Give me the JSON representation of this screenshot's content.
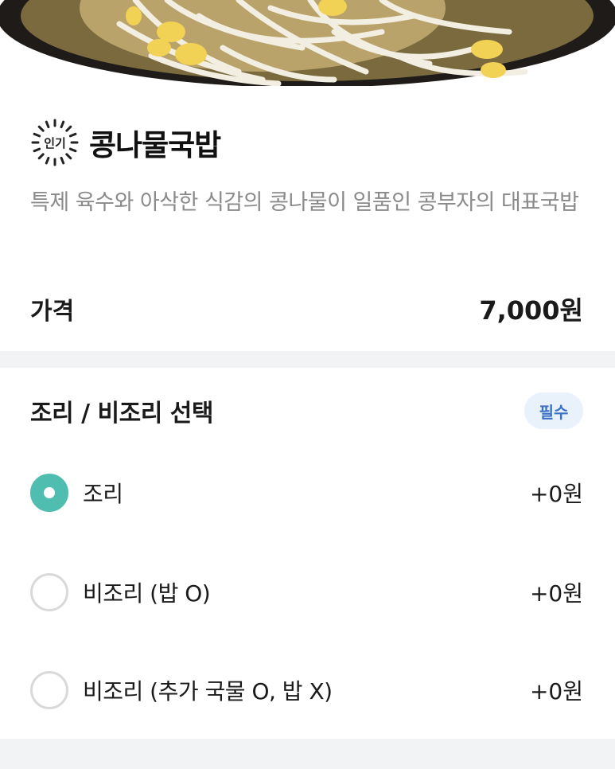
{
  "hero": {
    "image": "bean-sprout-soup-photo"
  },
  "menu": {
    "badge": "인기",
    "badge_icon": "popular-starburst-icon",
    "title": "콩나물국밥",
    "description": "특제 육수와 아삭한 식감의 콩나물이 일품인 콩부자의 대표국밥",
    "price_label": "가격",
    "price_value": "7,000원"
  },
  "options": {
    "title": "조리 / 비조리 선택",
    "required_label": "필수",
    "items": [
      {
        "label": "조리",
        "price": "+0원",
        "selected": true
      },
      {
        "label": "비조리 (밥 O)",
        "price": "+0원",
        "selected": false
      },
      {
        "label": "비조리 (추가 국물 O, 밥 X)",
        "price": "+0원",
        "selected": false
      }
    ]
  },
  "colors": {
    "accent": "#4fbdb0",
    "required_badge_bg": "#e9f1fb",
    "required_badge_text": "#3a72c4",
    "description_text": "#8a8a8a",
    "section_divider": "#f2f3f5"
  }
}
